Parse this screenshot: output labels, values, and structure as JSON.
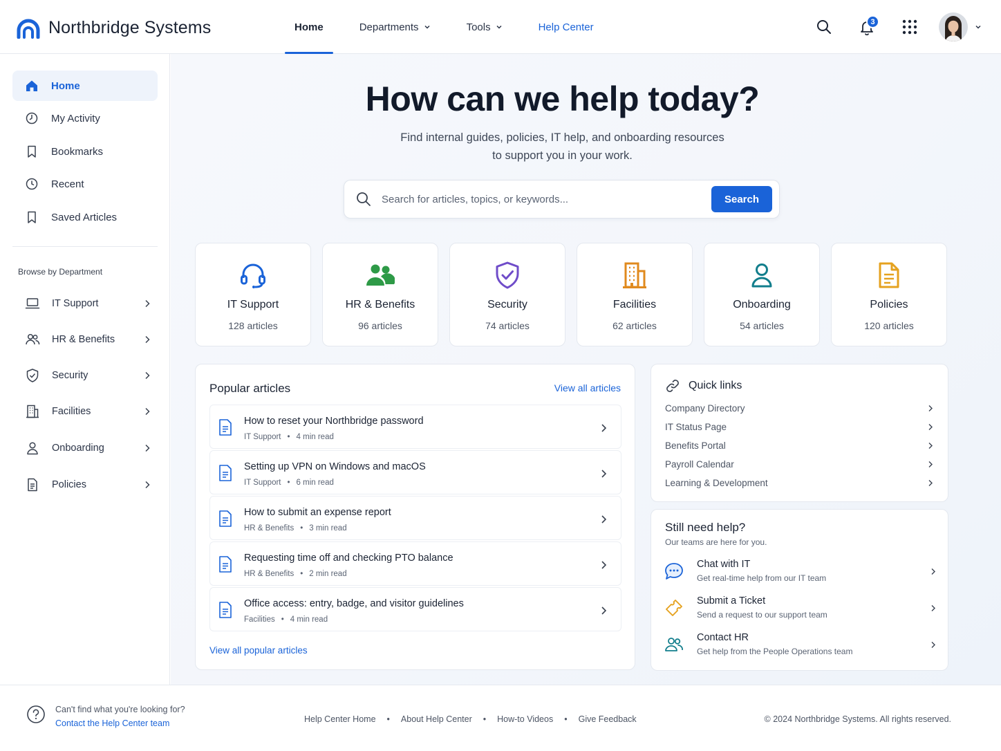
{
  "brand": {
    "name": "Northbridge Systems",
    "accent": "#1a63d8"
  },
  "topnav": {
    "items": [
      {
        "label": "Home"
      },
      {
        "label": "Departments"
      },
      {
        "label": "Tools"
      },
      {
        "label": "Help Center"
      }
    ],
    "notification_count": "3"
  },
  "sidebar": {
    "items": [
      {
        "label": "Home",
        "icon": "home-icon"
      },
      {
        "label": "My Activity",
        "icon": "activity-icon"
      },
      {
        "label": "Bookmarks",
        "icon": "bookmark-icon"
      },
      {
        "label": "Recent",
        "icon": "clock-icon"
      },
      {
        "label": "Saved Articles",
        "icon": "bookmark-icon"
      }
    ],
    "browse_heading": "Browse by Department",
    "departments": [
      {
        "label": "IT Support",
        "icon": "laptop-icon"
      },
      {
        "label": "HR & Benefits",
        "icon": "people-icon"
      },
      {
        "label": "Security",
        "icon": "shield-icon"
      },
      {
        "label": "Facilities",
        "icon": "building-icon"
      },
      {
        "label": "Onboarding",
        "icon": "person-icon"
      },
      {
        "label": "Policies",
        "icon": "document-icon"
      }
    ]
  },
  "hero": {
    "title": "How  can we help today?",
    "subtitle_line1": "Find internal guides, policies, IT help, and onboarding resources",
    "subtitle_line2": "to support you in your work.",
    "search_placeholder": "Search for articles, topics, or keywords...",
    "search_button": "Search"
  },
  "categories": [
    {
      "title": "IT Support",
      "count": "128 articles",
      "color": "#1a63d8",
      "icon": "headset-icon"
    },
    {
      "title": "HR & Benefits",
      "count": "96 articles",
      "color": "#2e9a47",
      "icon": "people-icon"
    },
    {
      "title": "Security",
      "count": "74 articles",
      "color": "#6f4cc9",
      "icon": "shield-check-icon"
    },
    {
      "title": "Facilities",
      "count": "62 articles",
      "color": "#e08a1e",
      "icon": "building-icon"
    },
    {
      "title": "Onboarding",
      "count": "54 articles",
      "color": "#127e8c",
      "icon": "person-icon"
    },
    {
      "title": "Policies",
      "count": "120 articles",
      "color": "#e5a21f",
      "icon": "document-icon"
    }
  ],
  "popular": {
    "title": "Popular articles",
    "view_all": "View all articles",
    "articles": [
      {
        "title": "How to reset your Northbridge password",
        "dept": "IT Support",
        "read": "4 min read"
      },
      {
        "title": "Setting up VPN on Windows and macOS",
        "dept": "IT Support",
        "read": "6 min read"
      },
      {
        "title": "How to submit an expense report",
        "dept": "HR & Benefits",
        "read": "3 min read"
      },
      {
        "title": "Requesting time off and checking PTO balance",
        "dept": "HR & Benefits",
        "read": "2 min read"
      },
      {
        "title": "Office access: entry, badge, and visitor guidelines",
        "dept": "Facilities",
        "read": "4 min read"
      }
    ],
    "view_popular": "View all popular articles"
  },
  "quick_links": {
    "title": "Quick links",
    "links": [
      {
        "label": "Company Directory"
      },
      {
        "label": "IT Status Page"
      },
      {
        "label": "Benefits Portal"
      },
      {
        "label": "Payroll Calendar"
      },
      {
        "label": "Learning & Development"
      }
    ]
  },
  "need_help": {
    "title": "Still need help?",
    "subtitle": "Our teams are here for you.",
    "options": [
      {
        "title": "Chat with IT",
        "desc": "Get real-time help from our IT team",
        "icon": "chat-icon"
      },
      {
        "title": "Submit a Ticket",
        "desc": "Send a request to our support team",
        "icon": "ticket-icon"
      },
      {
        "title": "Contact HR",
        "desc": "Get help from the People Operations team",
        "icon": "people-icon"
      }
    ]
  },
  "footer": {
    "cant_find": "Can't find what you're looking for?",
    "contact": "Contact the Help Center team",
    "links": [
      {
        "label": "Help Center Home"
      },
      {
        "label": "About Help Center"
      },
      {
        "label": "How-to Videos"
      },
      {
        "label": "Give Feedback"
      }
    ],
    "copyright": "© 2024 Northbridge Systems. All rights reserved."
  }
}
